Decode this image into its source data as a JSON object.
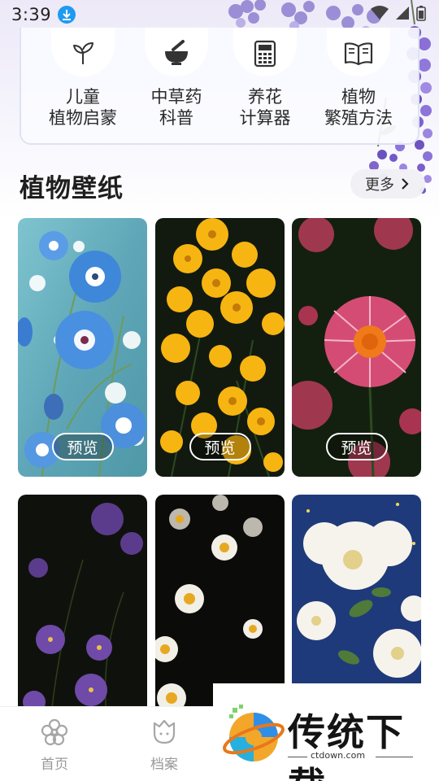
{
  "status_bar": {
    "time": "3:39"
  },
  "tools": [
    {
      "label": "儿童\n植物启蒙",
      "icon": "sprout-icon"
    },
    {
      "label": "中草药\n科普",
      "icon": "mortar-pestle-icon"
    },
    {
      "label": "养花\n计算器",
      "icon": "calculator-icon"
    },
    {
      "label": "植物\n繁殖方法",
      "icon": "book-icon"
    }
  ],
  "section": {
    "title": "植物壁纸",
    "more_label": "更多"
  },
  "wallpapers": [
    {
      "name": "blue-nemophila",
      "preview_label": "预览"
    },
    {
      "name": "yellow-cosmos",
      "preview_label": "预览"
    },
    {
      "name": "pink-strawflower",
      "preview_label": "预览"
    },
    {
      "name": "purple-flowers-dark"
    },
    {
      "name": "white-daisies-dark"
    },
    {
      "name": "white-peony-painting"
    }
  ],
  "bottom_nav": [
    {
      "label": "首页",
      "icon": "flower-icon"
    },
    {
      "label": "档案",
      "icon": "tulip-icon"
    }
  ],
  "watermark": {
    "brand": "传统下载",
    "domain": "ctdown.com"
  },
  "colors": {
    "accent_blue": "#1e9bf0",
    "background": "#ffffff",
    "nav_gray": "#9a9a9a"
  }
}
